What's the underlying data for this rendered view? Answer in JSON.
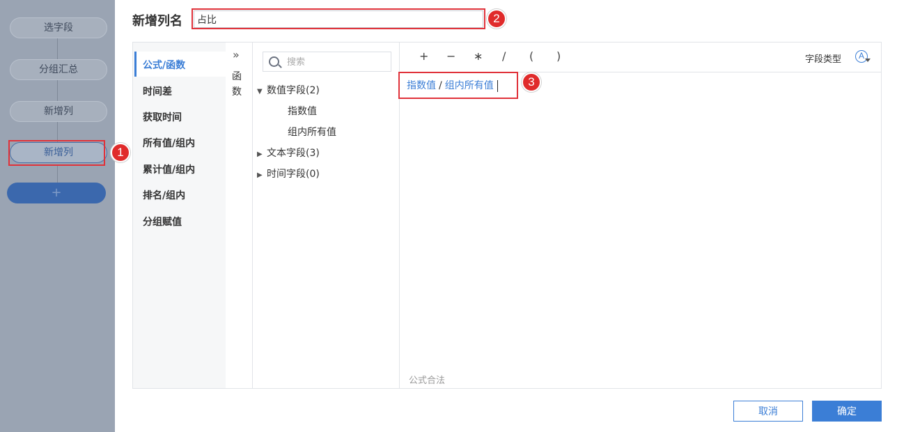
{
  "steps": [
    {
      "label": "选字段"
    },
    {
      "label": "分组汇总"
    },
    {
      "label": "新增列"
    },
    {
      "label": "新增列"
    }
  ],
  "add_step_label": "+",
  "header": {
    "label": "新增列名",
    "column_name_value": "占比"
  },
  "annotations": {
    "one": "1",
    "two": "2",
    "three": "3"
  },
  "categories": [
    {
      "label": "公式/函数",
      "active": true
    },
    {
      "label": "时间差"
    },
    {
      "label": "获取时间"
    },
    {
      "label": "所有值/组内"
    },
    {
      "label": "累计值/组内"
    },
    {
      "label": "排名/组内"
    },
    {
      "label": "分组赋值"
    }
  ],
  "function_tab": {
    "icon": "double-chevron-right-icon",
    "char1": "函",
    "char2": "数"
  },
  "search": {
    "placeholder": "搜索"
  },
  "field_tree": {
    "numeric_group": "数值字段(2)",
    "numeric_children": [
      "指数值",
      "组内所有值"
    ],
    "text_group": "文本字段(3)",
    "time_group": "时间字段(0)"
  },
  "operators": [
    "+",
    "−",
    "∗",
    "/",
    "(",
    ")"
  ],
  "field_type": {
    "label": "字段类型",
    "icon_text": "A"
  },
  "formula": {
    "token1": "指数值",
    "operator": "/",
    "token2": "组内所有值"
  },
  "formula_status": "公式合法",
  "buttons": {
    "cancel": "取消",
    "ok": "确定"
  },
  "colors": {
    "accent": "#3b7ed6",
    "annotation": "#e0323a",
    "side_panel": "#9aa4b3"
  }
}
